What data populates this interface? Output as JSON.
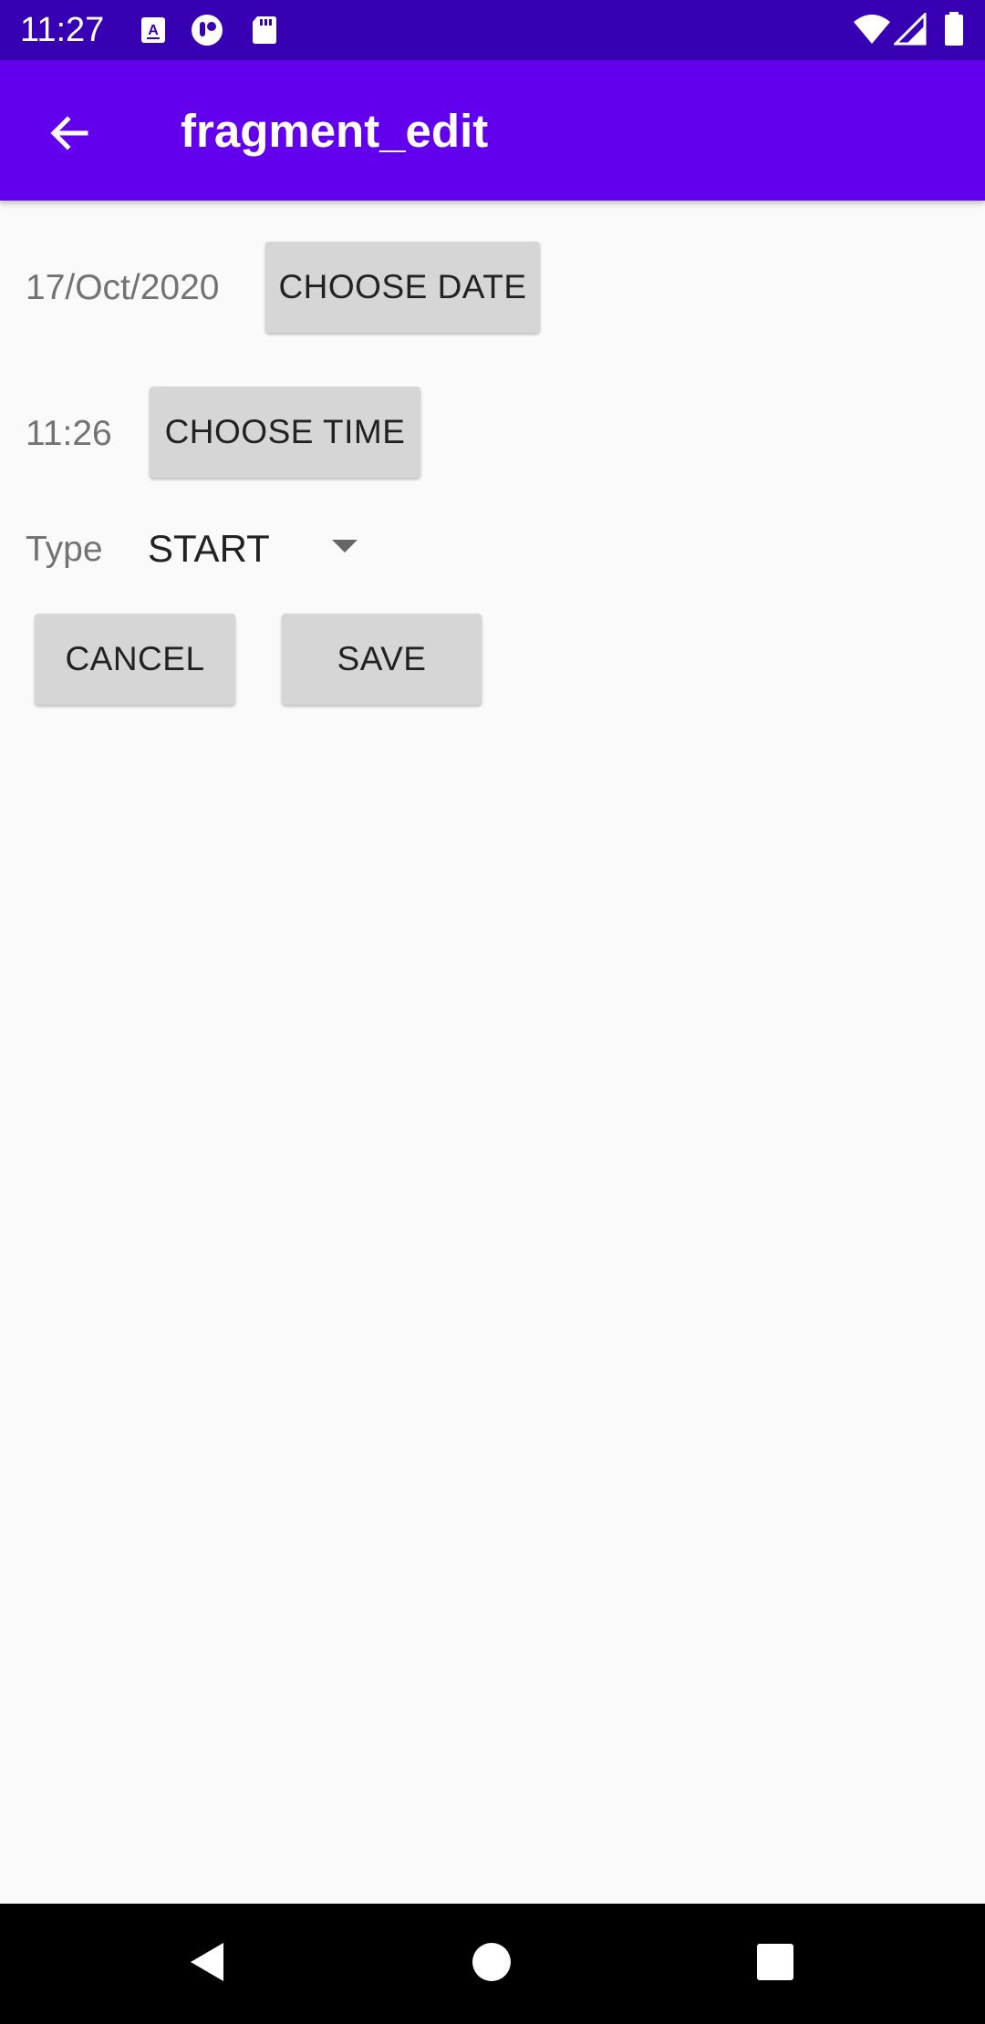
{
  "status_bar": {
    "time": "11:27",
    "notification_icons": [
      "text-a-icon",
      "circle-app-icon",
      "sd-card-icon"
    ],
    "system_icons": [
      "wifi-icon",
      "signal-icon",
      "battery-icon"
    ],
    "color": "#3700b3"
  },
  "app_bar": {
    "title": "fragment_edit",
    "back_icon": "arrow-back-icon",
    "color": "#6200ee"
  },
  "form": {
    "date_value": "17/Oct/2020",
    "choose_date_label": "CHOOSE DATE",
    "time_value": "11:26",
    "choose_time_label": "CHOOSE TIME",
    "type_label": "Type",
    "type_selected": "START",
    "cancel_label": "CANCEL",
    "save_label": "SAVE"
  },
  "nav_bar": {
    "icons": [
      "back-triangle-icon",
      "home-circle-icon",
      "recents-square-icon"
    ]
  }
}
